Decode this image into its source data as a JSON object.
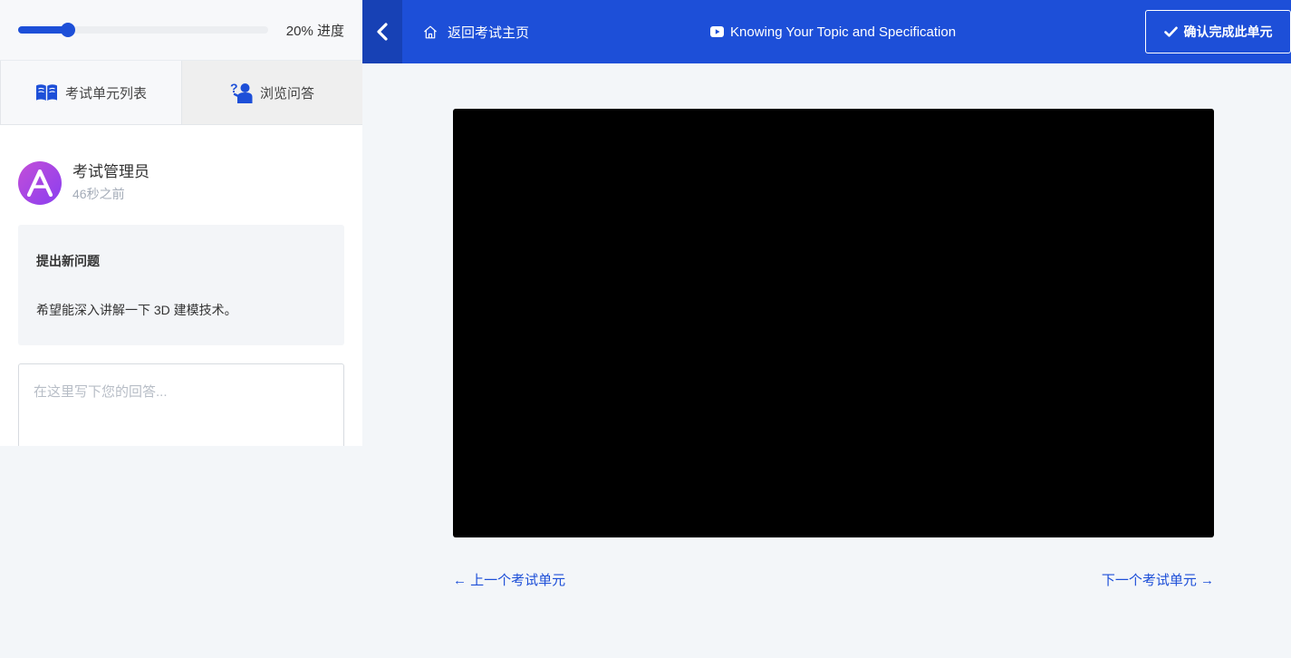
{
  "sidebar": {
    "progress": {
      "percent": 20,
      "label": "20% 进度"
    },
    "tabs": [
      {
        "label": "考试单元列表",
        "icon": "book-open-icon"
      },
      {
        "label": "浏览问答",
        "icon": "question-person-icon"
      }
    ],
    "post": {
      "avatar_letter": "A",
      "author": "考试管理员",
      "time": "46秒之前",
      "question_title": "提出新问题",
      "question_body": "希望能深入讲解一下 3D 建模技术。"
    },
    "answer": {
      "placeholder": "在这里写下您的回答..."
    }
  },
  "topbar": {
    "toggle_icon": "chevron-left-icon",
    "home_label": "返回考试主页",
    "home_icon": "home-icon",
    "lesson_icon": "video-play-icon",
    "lesson_title": "Knowing Your Topic and Specification",
    "complete_label": "确认完成此单元",
    "complete_icon": "check-icon"
  },
  "navigation": {
    "prev_label": "← 上一个考试单元",
    "next_label": "下一个考试单元 →"
  },
  "colors": {
    "accent": "#1d4fd8",
    "accent_dark": "#1741b5",
    "avatar_gradient_start": "#c34ed8",
    "avatar_gradient_end": "#8a3ff0"
  }
}
